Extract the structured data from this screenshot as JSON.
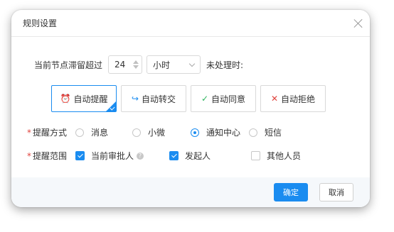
{
  "dialog": {
    "title": "规则设置",
    "close_icon": "close-icon"
  },
  "timeout": {
    "label": "当前节点滞留超过",
    "value": "24",
    "unit": "小时",
    "suffix": "未处理时:"
  },
  "actions": [
    {
      "label": "自动提醒",
      "icon": "alarm-clock-icon",
      "icon_char": "⏰",
      "icon_color": "#f0a020",
      "selected": true
    },
    {
      "label": "自动转交",
      "icon": "forward-icon",
      "icon_char": "↪",
      "icon_color": "#1a8cf0",
      "selected": false
    },
    {
      "label": "自动同意",
      "icon": "check-circle-icon",
      "icon_char": "✓",
      "icon_color": "#2db55d",
      "selected": false
    },
    {
      "label": "自动拒绝",
      "icon": "close-circle-icon",
      "icon_char": "✕",
      "icon_color": "#e0443e",
      "selected": false
    }
  ],
  "remind_method": {
    "label": "提醒方式",
    "options": [
      {
        "label": "消息",
        "selected": false
      },
      {
        "label": "小微",
        "selected": false
      },
      {
        "label": "通知中心",
        "selected": true
      },
      {
        "label": "短信",
        "selected": false
      }
    ]
  },
  "remind_scope": {
    "label": "提醒范围",
    "options": [
      {
        "label": "当前审批人",
        "checked": true,
        "help": true
      },
      {
        "label": "发起人",
        "checked": true
      },
      {
        "label": "其他人员",
        "checked": false
      }
    ]
  },
  "footer": {
    "ok_label": "确定",
    "cancel_label": "取消"
  },
  "colors": {
    "accent": "#1a8cf0",
    "required": "#e0443e"
  }
}
